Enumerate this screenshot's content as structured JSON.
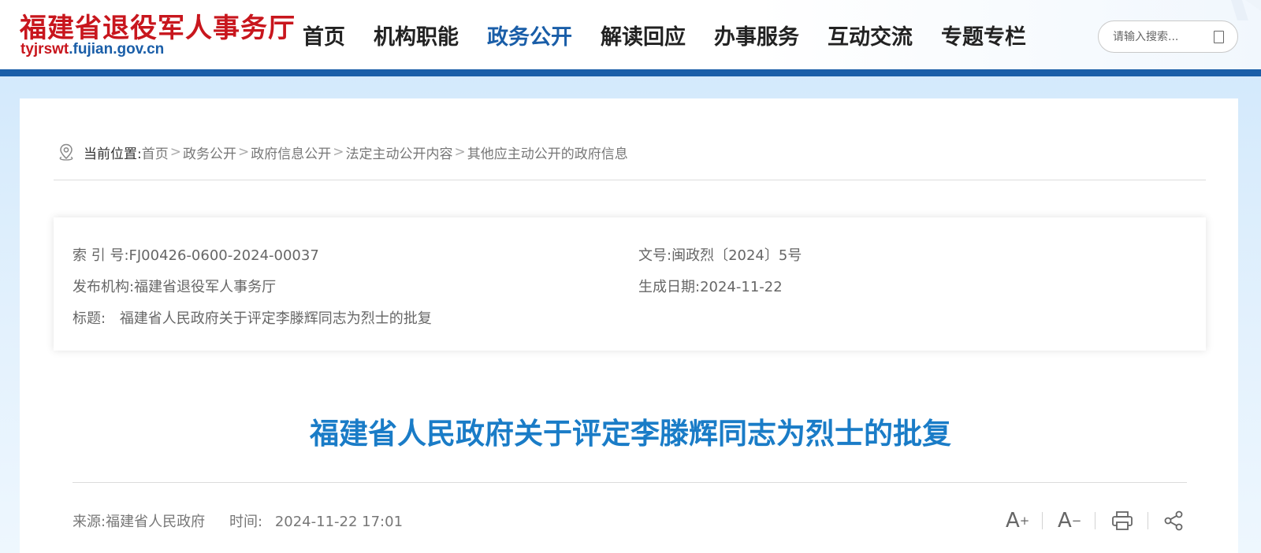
{
  "header": {
    "logo_cn": "福建省退役军人事务厅",
    "logo_url_prefix": "tyjrswt",
    "logo_url_suffix": ".fujian.gov.cn",
    "nav": [
      {
        "label": "首页"
      },
      {
        "label": "机构职能"
      },
      {
        "label": "政务公开",
        "active": true
      },
      {
        "label": "解读回应"
      },
      {
        "label": "办事服务"
      },
      {
        "label": "互动交流"
      },
      {
        "label": "专题专栏"
      }
    ],
    "search_placeholder": "请输入搜索..."
  },
  "breadcrumb": {
    "label": "当前位置:",
    "items": [
      "首页",
      "政务公开",
      "政府信息公开",
      "法定主动公开内容",
      "其他应主动公开的政府信息"
    ],
    "separator": ">"
  },
  "info": {
    "index_no": "索 引 号:FJ00426-0600-2024-00037",
    "doc_no": "文号:闽政烈〔2024〕5号",
    "publisher": "发布机构:福建省退役军人事务厅",
    "date": "生成日期:2024-11-22",
    "title_label": "标题:",
    "title_value": "福建省人民政府关于评定李滕辉同志为烈士的批复"
  },
  "article": {
    "title": "福建省人民政府关于评定李滕辉同志为烈士的批复",
    "source": "来源:福建省人民政府",
    "time_label": "时间:",
    "time_value": "2024-11-22 17:01"
  },
  "tools": {
    "font_increase": "A",
    "font_increase_sup": "+",
    "font_decrease": "A",
    "font_decrease_sup": "−"
  },
  "colors": {
    "brand_blue": "#1a5ea8",
    "logo_red": "#c8161d",
    "title_blue": "#1a7cc7"
  }
}
